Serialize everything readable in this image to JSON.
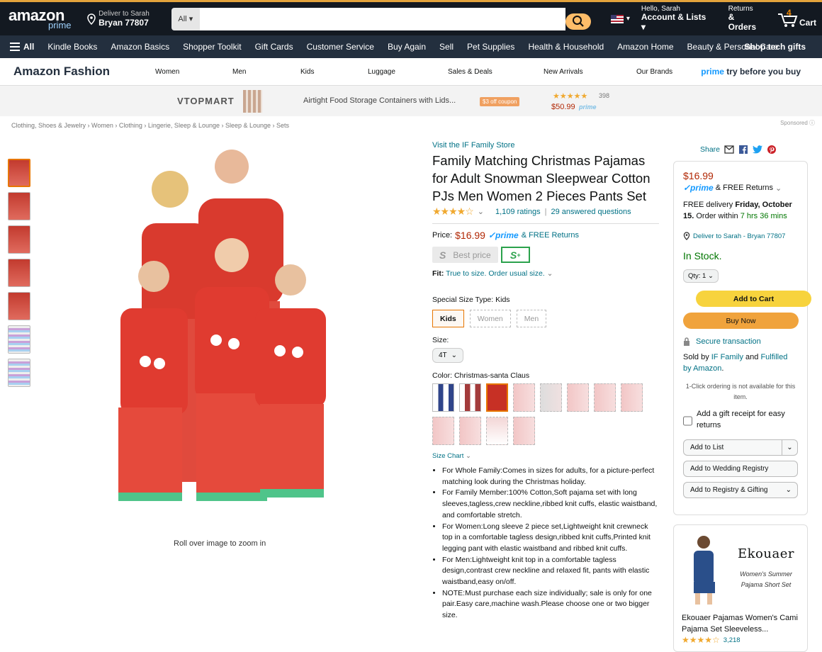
{
  "nav": {
    "logo": "amazon",
    "logo_sub": "prime",
    "deliver_line1": "Deliver to Sarah",
    "deliver_line2": "Bryan 77807",
    "search_category": "All",
    "search_value": "",
    "account_line1": "Hello, Sarah",
    "account_line2": "Account & Lists",
    "returns_line1": "Returns",
    "returns_line2": "& Orders",
    "cart_count": "4",
    "cart_label": "Cart"
  },
  "subnav": {
    "all": "All",
    "items": [
      "Kindle Books",
      "Amazon Basics",
      "Shopper Toolkit",
      "Gift Cards",
      "Customer Service",
      "Buy Again",
      "Sell",
      "Pet Supplies",
      "Health & Household",
      "Amazon Home",
      "Beauty & Personal Care"
    ],
    "right": "Shop tech gifts"
  },
  "fashion": {
    "title": "Amazon Fashion",
    "links": [
      "Women",
      "Men",
      "Kids",
      "Luggage",
      "Sales & Deals",
      "New Arrivals",
      "Our Brands"
    ],
    "prime_word": "prime",
    "prime_rest": " try before you buy"
  },
  "ad_banner": {
    "brand": "VTOPMART",
    "text": "Airtight Food Storage Containers with Lids...",
    "coupon": "$3 off coupon",
    "stars": "★★★★★",
    "count": "398",
    "price": "$50.99",
    "prime": "prime"
  },
  "breadcrumb": "Clothing, Shoes & Jewelry › Women › Clothing › Lingerie, Sleep & Lounge › Sleep & Lounge › Sets",
  "sponsored": "Sponsored ⓘ",
  "gallery": {
    "zoom_text": "Roll over image to zoom in"
  },
  "product": {
    "store": "Visit the IF Family Store",
    "title": "Family Matching Christmas Pajamas for Adult Snowman Sleepwear Cotton PJs Men Women 2 Pieces Pants Set",
    "stars": "★★★★☆",
    "ratings": "1,109 ratings",
    "answered": "29 answered questions",
    "price_label": "Price:",
    "price": "$16.99",
    "prime": "✓prime",
    "free_returns": "& FREE Returns",
    "best_price": "Best price",
    "fit_label": "Fit:",
    "fit_value": "True to size. Order usual size.",
    "special_label": "Special Size Type:",
    "special_value": "Kids",
    "size_types": [
      "Kids",
      "Women",
      "Men"
    ],
    "size_label": "Size:",
    "size_value": "4T",
    "color_label": "Color:",
    "color_value": "Christmas-santa Claus",
    "size_chart": "Size Chart",
    "bullets": [
      "For Whole Family:Comes in sizes for adults, for a picture-perfect matching look during the Christmas holiday.",
      "For Family Member:100% Cotton,Soft pajama set with long sleeves,tagless,crew neckline,ribbed knit cuffs, elastic waistband, and comfortable stretch.",
      "For Women:Long sleeve 2 piece set,Lightweight knit crewneck top in a comfortable tagless design,ribbed knit cuffs,Printed knit legging pant with elastic waistband and ribbed knit cuffs.",
      "For Men:Lightweight knit top in a comfortable tagless design,contrast crew neckline and relaxed fit, pants with elastic waistband,easy on/off.",
      "NOTE:Must purchase each size individually; sale is only for one pair.Easy care,machine wash.Please choose one or two bigger size."
    ]
  },
  "share": "Share",
  "buybox": {
    "price": "$16.99",
    "prime": "✓prime",
    "free_returns": "& FREE Returns",
    "delivery_pre": "FREE delivery ",
    "delivery_date": "Friday, October 15.",
    "order_within": " Order within ",
    "time": "7 hrs 36 mins",
    "deliver_to": "Deliver to Sarah - Bryan 77807",
    "stock": "In Stock.",
    "qty": "Qty: 1",
    "add_to_cart": "Add to Cart",
    "buy_now": "Buy Now",
    "secure": "Secure transaction",
    "sold_by_pre": "Sold by ",
    "seller": "IF Family",
    "sold_mid": " and ",
    "fulfilled": "Fulfilled by Amazon",
    "one_click": "1-Click ordering is not available for this item.",
    "gift": "Add a gift receipt for easy returns",
    "add_to_list": "Add to List",
    "wedding": "Add to Wedding Registry",
    "registry": "Add to Registry & Gifting"
  },
  "side_ad": {
    "brand": "Ekouaer",
    "subtitle": "Women's Summer Pajama Short Set",
    "title": "Ekouaer Pajamas Women's Cami Pajama Set Sleeveless...",
    "stars": "★★★★☆",
    "count": "3,218"
  },
  "colors": {
    "nav_bg": "#131921",
    "subnav_bg": "#232f3e",
    "search_btn": "#febd69",
    "price_red": "#b12704",
    "link": "#007185",
    "cart_btn": "#f7d33d",
    "buy_btn": "#f0a33c"
  }
}
